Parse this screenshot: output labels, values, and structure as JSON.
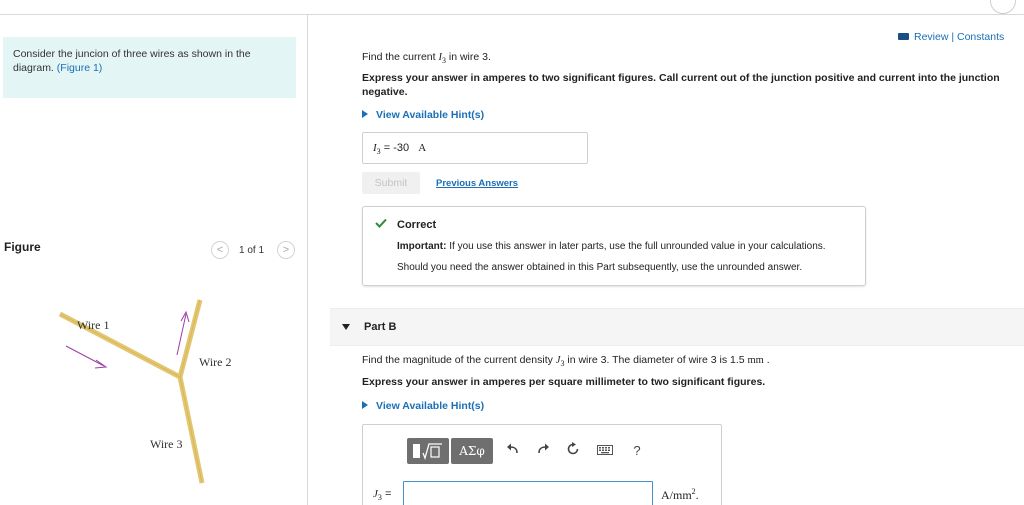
{
  "left": {
    "intro_text": "Consider the juncion of three wires as shown in the diagram.",
    "figure_link": "(Figure 1)",
    "figure_heading": "Figure",
    "page_count": "1 of 1",
    "wire_labels": [
      "Wire 1",
      "Wire 2",
      "Wire 3"
    ]
  },
  "header": {
    "review_link": "Review | Constants"
  },
  "part_a": {
    "question_prefix": "Find the current ",
    "question_var": "I",
    "question_sub": "3",
    "question_suffix": " in wire 3.",
    "instruction": "Express your answer in amperes to two significant figures. Call current out of the junction positive and current into the junction negative.",
    "hint_label": "View Available Hint(s)",
    "answer_var": "I",
    "answer_sub": "3",
    "answer_eq": " =  ",
    "answer_value": "-30",
    "answer_unit": "A",
    "submit_label": "Submit",
    "previous_answers_label": "Previous Answers",
    "feedback": {
      "title": "Correct",
      "important_label": "Important:",
      "important_text": " If you use this answer in later parts, use the full unrounded value in your calculations.",
      "unrounded_text": "Should you need the answer obtained in this Part subsequently, use the unrounded answer."
    }
  },
  "part_b": {
    "label": "Part B",
    "question_prefix": "Find the magnitude of the current density ",
    "question_var": "J",
    "question_sub": "3",
    "question_mid": " in wire 3. The diameter of wire 3 is 1.5 ",
    "question_unit": "mm",
    "question_end": " .",
    "instruction": "Express your answer in amperes per square millimeter to two significant figures.",
    "hint_label": "View Available Hint(s)",
    "toolbar_symbols": "ΑΣφ",
    "help_label": "?",
    "input_label_var": "J",
    "input_label_sub": "3",
    "input_label_eq": " =",
    "units_text": "A/mm",
    "units_sup": "2",
    "units_end": "."
  },
  "colors": {
    "accent_link": "#1a6fb6",
    "intro_bg": "#e4f5f6",
    "correct_check": "#2e8b3a",
    "wire": "#e3c66f",
    "arrow": "#9b3fa6"
  },
  "icons": {
    "check": "check-icon",
    "undo": "undo-icon",
    "redo": "redo-icon",
    "reset": "reset-icon",
    "keyboard": "keyboard-icon",
    "help": "help-icon"
  }
}
